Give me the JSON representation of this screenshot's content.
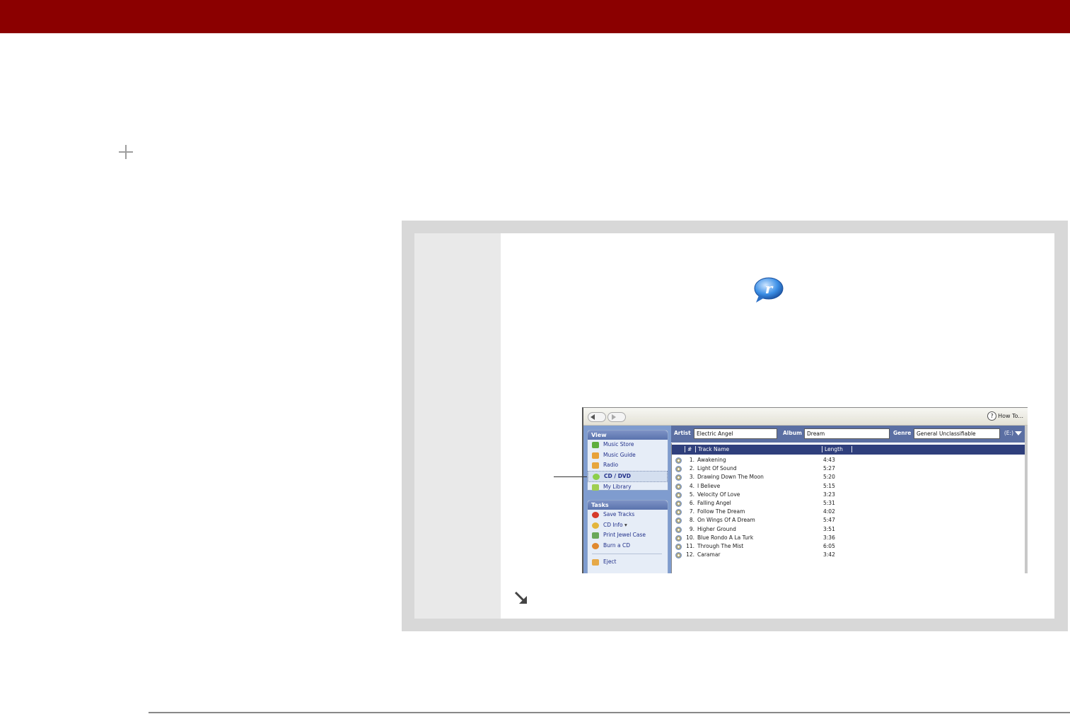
{
  "colors": {
    "top_bar": "#8b0000",
    "panel_gray": "#d8d8d8",
    "sidebar_header_blue": "#5a73ad",
    "track_header_navy": "#2f3f7c"
  },
  "icons": {
    "expand": "plus-icon",
    "logo": "realplayer-logo-icon",
    "continue": "arrow-down-right-icon"
  },
  "app": {
    "toolbar": {
      "howto_label": "How To..."
    },
    "view": {
      "heading": "View",
      "items": [
        {
          "label": "Music Store",
          "icon": "music-note-icon"
        },
        {
          "label": "Music Guide",
          "icon": "music-note-icon"
        },
        {
          "label": "Radio",
          "icon": "radio-icon"
        },
        {
          "label": "CD / DVD",
          "icon": "cd-icon"
        },
        {
          "label": "My Library",
          "icon": "library-icon"
        }
      ]
    },
    "tasks": {
      "heading": "Tasks",
      "items": [
        {
          "label": "Save Tracks",
          "icon": "record-icon"
        },
        {
          "label": "CD Info",
          "icon": "info-icon"
        },
        {
          "label": "Print Jewel Case",
          "icon": "print-icon"
        },
        {
          "label": "Burn a CD",
          "icon": "burn-icon"
        },
        {
          "label": "Eject",
          "icon": "eject-icon"
        }
      ]
    },
    "fields": {
      "artist_label": "Artist",
      "artist_value": "Electric Angel",
      "album_label": "Album",
      "album_value": "Dream",
      "genre_label": "Genre",
      "genre_value": "General Unclassifiable",
      "drive": "(E:)"
    },
    "columns": {
      "num": "#",
      "name": "Track Name",
      "length": "Length"
    },
    "tracks": [
      {
        "num": "1.",
        "name": "Awakening",
        "length": "4:43"
      },
      {
        "num": "2.",
        "name": "Light Of Sound",
        "length": "5:27"
      },
      {
        "num": "3.",
        "name": "Drawing Down The Moon",
        "length": "5:20"
      },
      {
        "num": "4.",
        "name": "I Believe",
        "length": "5:15"
      },
      {
        "num": "5.",
        "name": "Velocity Of Love",
        "length": "3:23"
      },
      {
        "num": "6.",
        "name": "Falling Angel",
        "length": "5:31"
      },
      {
        "num": "7.",
        "name": "Follow The Dream",
        "length": "4:02"
      },
      {
        "num": "8.",
        "name": "On Wings Of A Dream",
        "length": "5:47"
      },
      {
        "num": "9.",
        "name": "Higher Ground",
        "length": "3:51"
      },
      {
        "num": "10.",
        "name": "Blue Rondo A La Turk",
        "length": "3:36"
      },
      {
        "num": "11.",
        "name": "Through The Mist",
        "length": "6:05"
      },
      {
        "num": "12.",
        "name": "Caramar",
        "length": "3:42"
      }
    ]
  }
}
